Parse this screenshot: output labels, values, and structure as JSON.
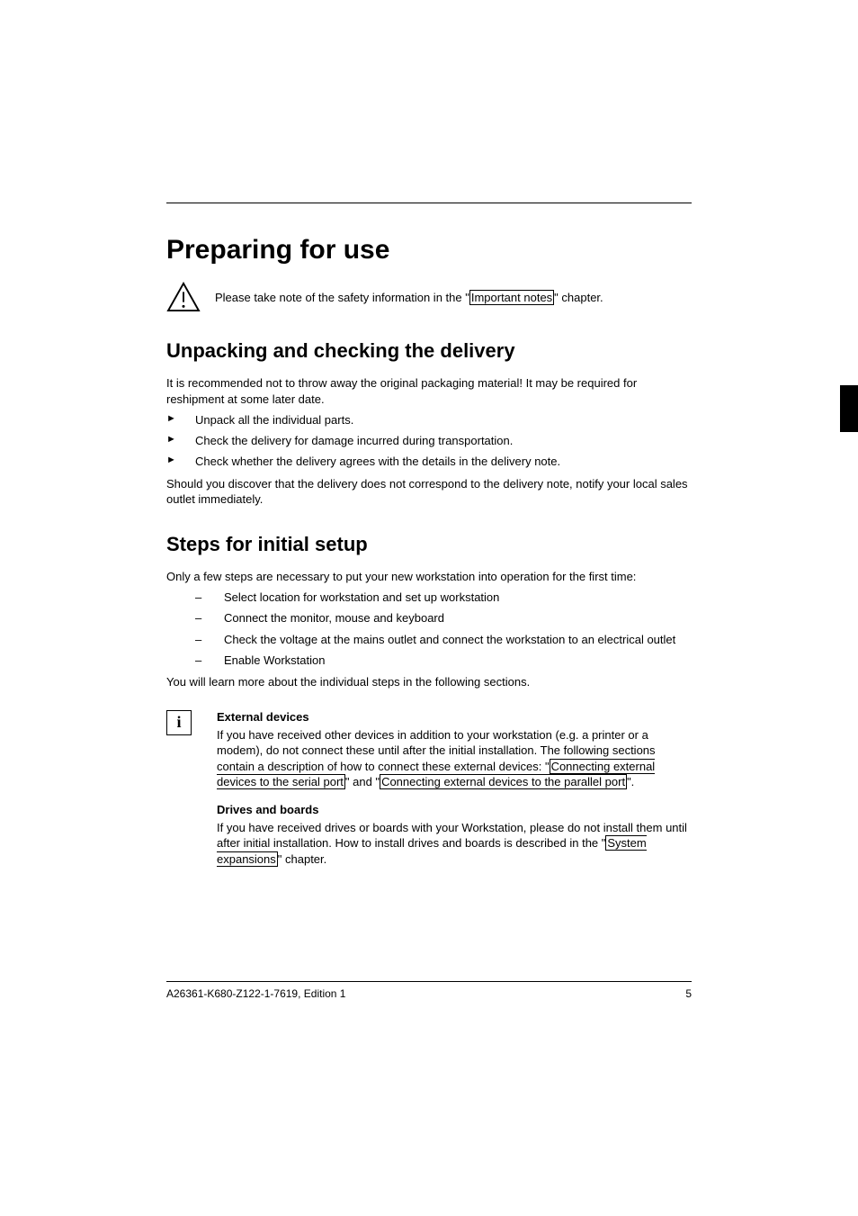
{
  "title": "Preparing for use",
  "warn": {
    "pre": "Please take note of the safety information in the \"",
    "link": "Important notes",
    "post": "\" chapter."
  },
  "sec1": {
    "heading": "Unpacking and checking the delivery",
    "intro": "It is recommended not to throw away the original packaging material! It may be required for reshipment at some later date.",
    "items": [
      "Unpack all the individual parts.",
      "Check the delivery for damage incurred during transportation.",
      "Check whether the delivery agrees with the details in the delivery note."
    ],
    "outro": "Should you discover that the delivery does not correspond to the delivery note, notify your local sales outlet immediately."
  },
  "sec2": {
    "heading": "Steps for initial setup",
    "intro": "Only a few steps are necessary to put your new workstation into operation for the first time:",
    "items": [
      "Select location for workstation and set up workstation",
      "Connect the monitor, mouse and keyboard",
      "Check the voltage at the mains outlet and connect the workstation to an electrical outlet",
      "Enable Workstation"
    ],
    "outro": "You will learn more about the individual steps in the following sections."
  },
  "info": {
    "glyph": "i",
    "block1": {
      "head": "External devices",
      "pre": "If you have received other devices in addition to your workstation (e.g. a printer or a modem), do not connect these until after the initial installation. The following sections contain a description of how to connect these external devices: \"",
      "link1": "Connecting external devices to the serial port",
      "mid": "\" and \"",
      "link2": "Connecting external devices to the parallel port",
      "post": "\"."
    },
    "block2": {
      "head": "Drives and boards",
      "pre": "If you have received drives or boards with your Workstation, please do not install them until after initial installation. How to install drives and boards is described in the \"",
      "link": "System expansions",
      "post": "\" chapter."
    }
  },
  "footer": {
    "left": "A26361-K680-Z122-1-7619, Edition 1",
    "right": "5"
  }
}
